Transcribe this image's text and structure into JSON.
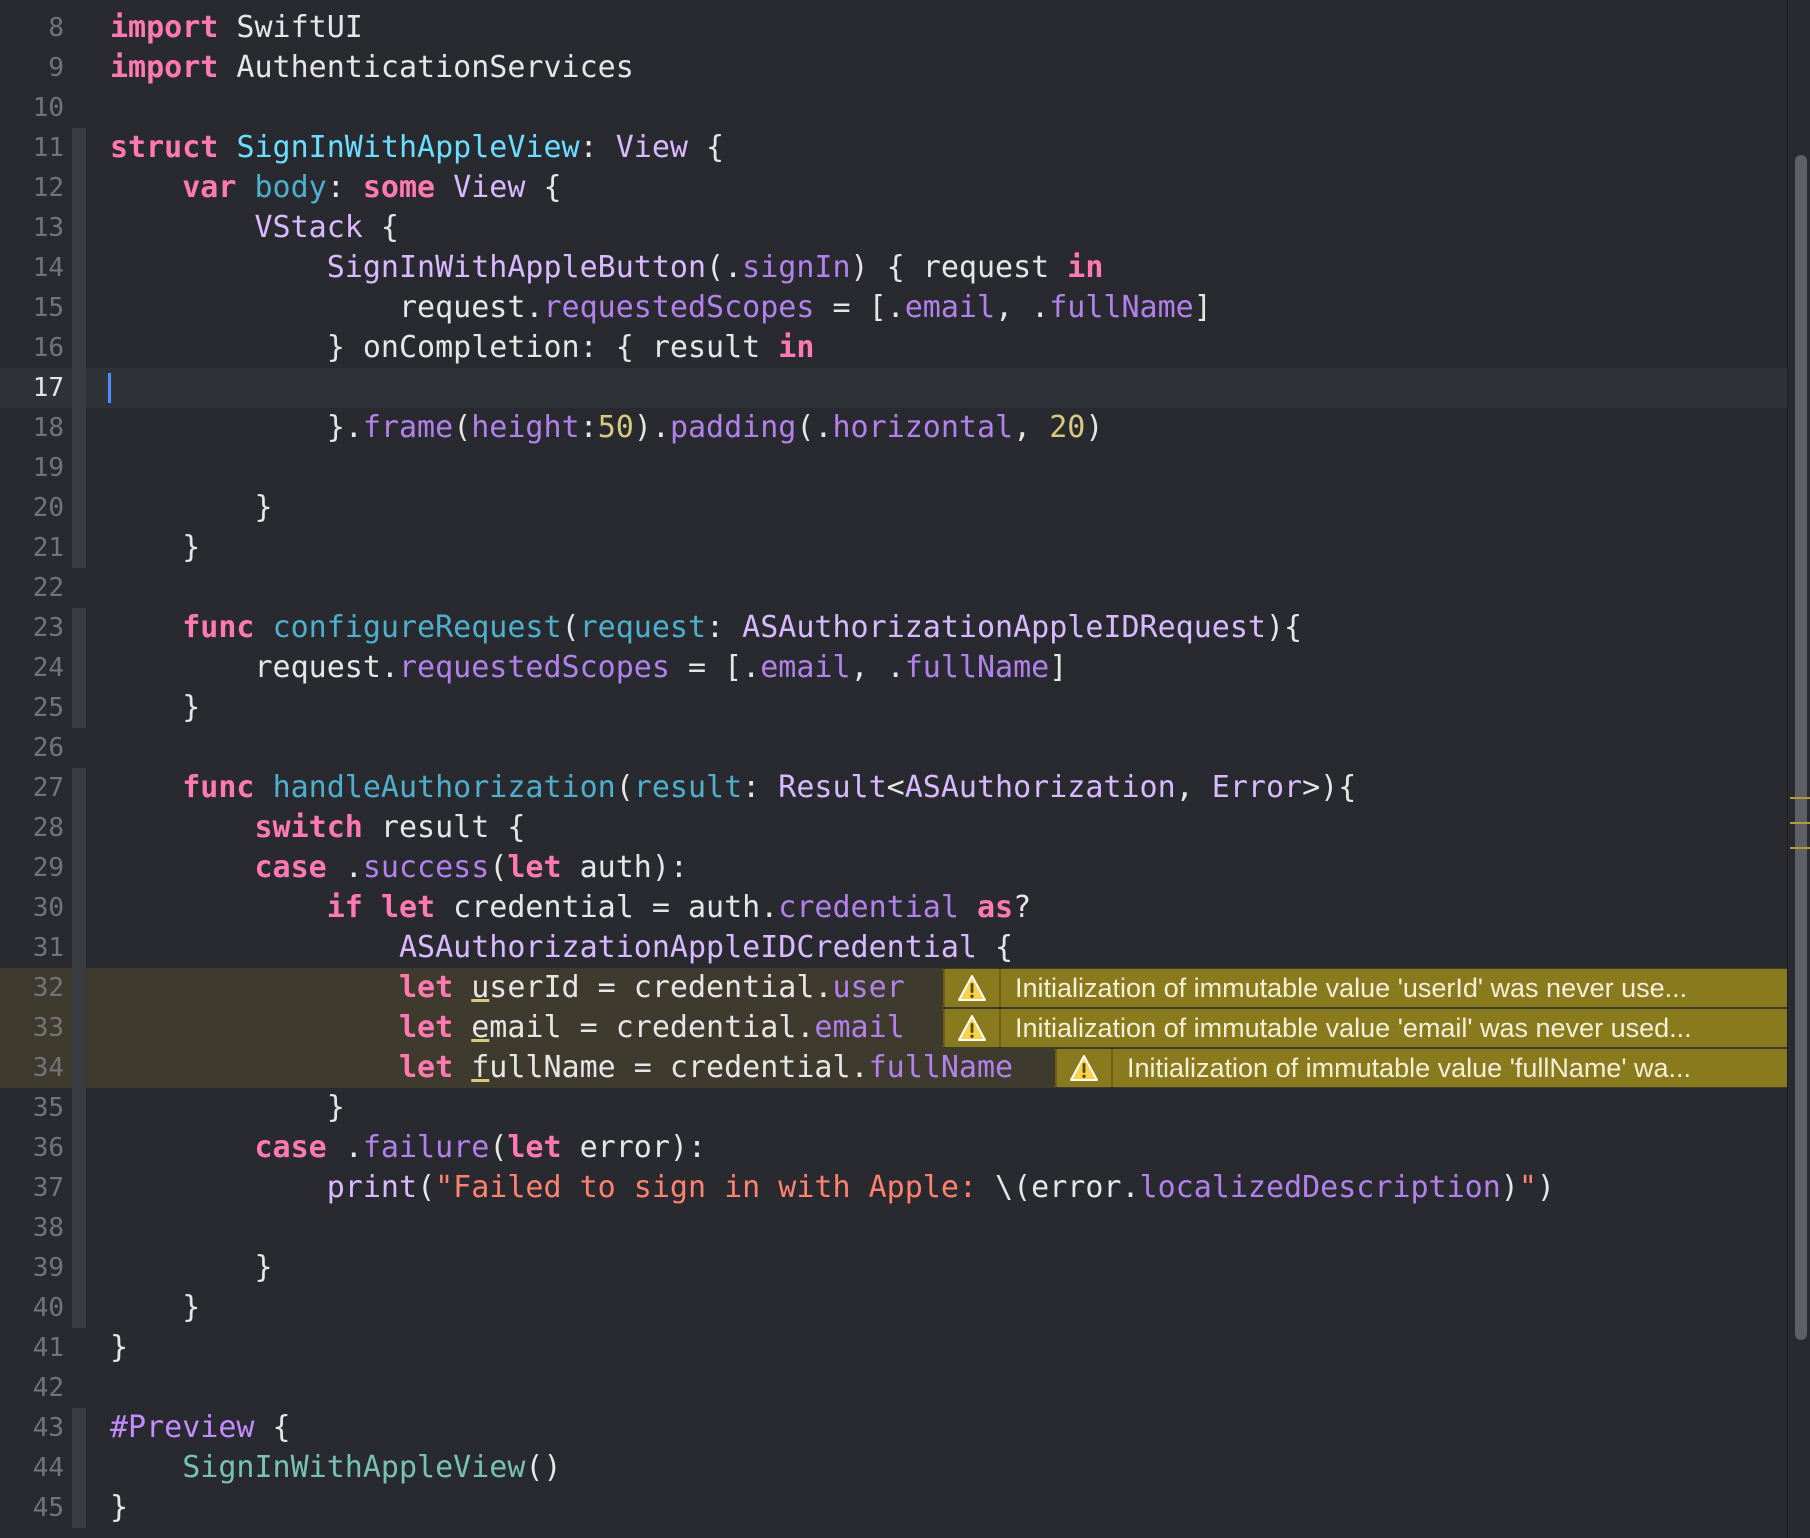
{
  "editor": {
    "current_line": "17",
    "lines": [
      {
        "n": "8",
        "parts": [
          [
            "k",
            "import"
          ],
          [
            "pl",
            " SwiftUI"
          ]
        ]
      },
      {
        "n": "9",
        "parts": [
          [
            "k",
            "import"
          ],
          [
            "pl",
            " AuthenticationServices"
          ]
        ]
      },
      {
        "n": "10",
        "parts": []
      },
      {
        "n": "11",
        "parts": [
          [
            "k",
            "struct"
          ],
          [
            "pl",
            " "
          ],
          [
            "tdecl",
            "SignInWithAppleView"
          ],
          [
            "pl",
            ": "
          ],
          [
            "t",
            "View"
          ],
          [
            "pl",
            " {"
          ]
        ]
      },
      {
        "n": "12",
        "parts": [
          [
            "pl",
            "    "
          ],
          [
            "k",
            "var"
          ],
          [
            "pl",
            " "
          ],
          [
            "pdecl",
            "body"
          ],
          [
            "pl",
            ": "
          ],
          [
            "k",
            "some"
          ],
          [
            "pl",
            " "
          ],
          [
            "t",
            "View"
          ],
          [
            "pl",
            " {"
          ]
        ]
      },
      {
        "n": "13",
        "parts": [
          [
            "pl",
            "        "
          ],
          [
            "t",
            "VStack"
          ],
          [
            "pl",
            " {"
          ]
        ]
      },
      {
        "n": "14",
        "parts": [
          [
            "pl",
            "            "
          ],
          [
            "t",
            "SignInWithAppleButton"
          ],
          [
            "pl",
            "(."
          ],
          [
            "m",
            "signIn"
          ],
          [
            "pl",
            ") { request "
          ],
          [
            "k",
            "in"
          ]
        ]
      },
      {
        "n": "15",
        "parts": [
          [
            "pl",
            "                request."
          ],
          [
            "m",
            "requestedScopes"
          ],
          [
            "pl",
            " = [."
          ],
          [
            "m",
            "email"
          ],
          [
            "pl",
            ", ."
          ],
          [
            "m",
            "fullName"
          ],
          [
            "pl",
            "]"
          ]
        ]
      },
      {
        "n": "16",
        "parts": [
          [
            "pl",
            "            } onCompletion: { result "
          ],
          [
            "k",
            "in"
          ]
        ]
      },
      {
        "n": "17",
        "parts": []
      },
      {
        "n": "18",
        "parts": [
          [
            "pl",
            "            }."
          ],
          [
            "m",
            "frame"
          ],
          [
            "pl",
            "("
          ],
          [
            "m",
            "height"
          ],
          [
            "pl",
            ":"
          ],
          [
            "n",
            "50"
          ],
          [
            "pl",
            ")."
          ],
          [
            "m",
            "padding"
          ],
          [
            "pl",
            "(."
          ],
          [
            "m",
            "horizontal"
          ],
          [
            "pl",
            ", "
          ],
          [
            "n",
            "20"
          ],
          [
            "pl",
            ")"
          ]
        ]
      },
      {
        "n": "19",
        "parts": []
      },
      {
        "n": "20",
        "parts": [
          [
            "pl",
            "        }"
          ]
        ]
      },
      {
        "n": "21",
        "parts": [
          [
            "pl",
            "    }"
          ]
        ]
      },
      {
        "n": "22",
        "parts": []
      },
      {
        "n": "23",
        "parts": [
          [
            "pl",
            "    "
          ],
          [
            "k",
            "func"
          ],
          [
            "pl",
            " "
          ],
          [
            "fdecl",
            "configureRequest"
          ],
          [
            "pl",
            "("
          ],
          [
            "pdecl",
            "request"
          ],
          [
            "pl",
            ": "
          ],
          [
            "t",
            "ASAuthorizationAppleIDRequest"
          ],
          [
            "pl",
            "){"
          ]
        ]
      },
      {
        "n": "24",
        "parts": [
          [
            "pl",
            "        request."
          ],
          [
            "m",
            "requestedScopes"
          ],
          [
            "pl",
            " = [."
          ],
          [
            "m",
            "email"
          ],
          [
            "pl",
            ", ."
          ],
          [
            "m",
            "fullName"
          ],
          [
            "pl",
            "]"
          ]
        ]
      },
      {
        "n": "25",
        "parts": [
          [
            "pl",
            "    }"
          ]
        ]
      },
      {
        "n": "26",
        "parts": []
      },
      {
        "n": "27",
        "parts": [
          [
            "pl",
            "    "
          ],
          [
            "k",
            "func"
          ],
          [
            "pl",
            " "
          ],
          [
            "fdecl",
            "handleAuthorization"
          ],
          [
            "pl",
            "("
          ],
          [
            "pdecl",
            "result"
          ],
          [
            "pl",
            ": "
          ],
          [
            "t",
            "Result"
          ],
          [
            "pl",
            "<"
          ],
          [
            "t",
            "ASAuthorization"
          ],
          [
            "pl",
            ", "
          ],
          [
            "t",
            "Error"
          ],
          [
            "pl",
            ">){"
          ]
        ]
      },
      {
        "n": "28",
        "parts": [
          [
            "pl",
            "        "
          ],
          [
            "k",
            "switch"
          ],
          [
            "pl",
            " result {"
          ]
        ]
      },
      {
        "n": "29",
        "parts": [
          [
            "pl",
            "        "
          ],
          [
            "k",
            "case"
          ],
          [
            "pl",
            " ."
          ],
          [
            "m",
            "success"
          ],
          [
            "pl",
            "("
          ],
          [
            "k",
            "let"
          ],
          [
            "pl",
            " auth):"
          ]
        ]
      },
      {
        "n": "30",
        "parts": [
          [
            "pl",
            "            "
          ],
          [
            "k",
            "if"
          ],
          [
            "pl",
            " "
          ],
          [
            "k",
            "let"
          ],
          [
            "pl",
            " credential = auth."
          ],
          [
            "m",
            "credential"
          ],
          [
            "pl",
            " "
          ],
          [
            "k",
            "as"
          ],
          [
            "pl",
            "?"
          ]
        ]
      },
      {
        "n": "31",
        "parts": [
          [
            "pl",
            "                "
          ],
          [
            "t",
            "ASAuthorizationAppleIDCredential"
          ],
          [
            "pl",
            " {"
          ]
        ]
      },
      {
        "n": "32",
        "warn": true,
        "parts": [
          [
            "pl",
            "                "
          ],
          [
            "k",
            "let"
          ],
          [
            "pl",
            " "
          ],
          [
            "u",
            "u"
          ],
          [
            "pl",
            "serId = credential."
          ],
          [
            "m",
            "user"
          ]
        ]
      },
      {
        "n": "33",
        "warn": true,
        "parts": [
          [
            "pl",
            "                "
          ],
          [
            "k",
            "let"
          ],
          [
            "pl",
            " "
          ],
          [
            "u",
            "e"
          ],
          [
            "pl",
            "mail = credential."
          ],
          [
            "m",
            "email"
          ]
        ]
      },
      {
        "n": "34",
        "warn": true,
        "parts": [
          [
            "pl",
            "                "
          ],
          [
            "k",
            "let"
          ],
          [
            "pl",
            " "
          ],
          [
            "u",
            "f"
          ],
          [
            "pl",
            "ullName = credential."
          ],
          [
            "m",
            "fullName"
          ]
        ]
      },
      {
        "n": "35",
        "parts": [
          [
            "pl",
            "            }"
          ]
        ]
      },
      {
        "n": "36",
        "parts": [
          [
            "pl",
            "        "
          ],
          [
            "k",
            "case"
          ],
          [
            "pl",
            " ."
          ],
          [
            "m",
            "failure"
          ],
          [
            "pl",
            "("
          ],
          [
            "k",
            "let"
          ],
          [
            "pl",
            " error):"
          ]
        ]
      },
      {
        "n": "37",
        "parts": [
          [
            "pl",
            "            "
          ],
          [
            "t",
            "print"
          ],
          [
            "pl",
            "("
          ],
          [
            "s",
            "\"Failed to sign in with Apple: "
          ],
          [
            "pl",
            "\\(error."
          ],
          [
            "m",
            "localizedDescription"
          ],
          [
            "pl",
            ")"
          ],
          [
            "s",
            "\""
          ],
          [
            "pl",
            ")"
          ]
        ]
      },
      {
        "n": "38",
        "parts": []
      },
      {
        "n": "39",
        "parts": [
          [
            "pl",
            "        }"
          ]
        ]
      },
      {
        "n": "40",
        "parts": [
          [
            "pl",
            "    }"
          ]
        ]
      },
      {
        "n": "41",
        "parts": [
          [
            "pl",
            "}"
          ]
        ]
      },
      {
        "n": "42",
        "parts": []
      },
      {
        "n": "43",
        "parts": [
          [
            "macro",
            "#Preview"
          ],
          [
            "pl",
            " {"
          ]
        ]
      },
      {
        "n": "44",
        "parts": [
          [
            "pl",
            "    "
          ],
          [
            "g",
            "SignInWithAppleView"
          ],
          [
            "pl",
            "()"
          ]
        ]
      },
      {
        "n": "45",
        "parts": [
          [
            "pl",
            "}"
          ]
        ]
      }
    ],
    "warnings": {
      "32": "Initialization of immutable value 'userId' was never use...",
      "33": "Initialization of immutable value 'email' was never used...",
      "34": "Initialization of immutable value 'fullName' wa..."
    },
    "warning_icon": "warning-triangle-icon",
    "colors": {
      "background": "#292a30",
      "keyword": "#ff7ab2",
      "type": "#dabaff",
      "member": "#b281eb",
      "number": "#d9c97c",
      "string": "#ff8170",
      "warning_banner": "#8a7a1e"
    }
  }
}
